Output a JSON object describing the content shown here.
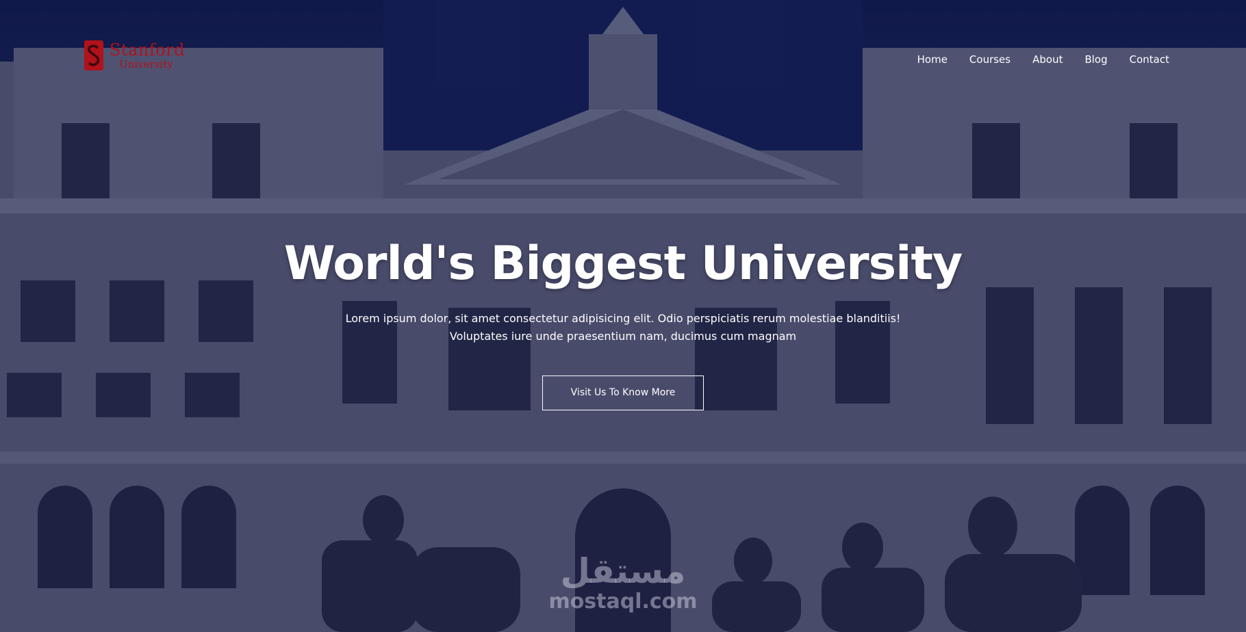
{
  "brand": {
    "name": "Stanford",
    "sub": "University",
    "color": "#b1121b"
  },
  "nav": {
    "items": [
      {
        "label": "Home"
      },
      {
        "label": "Courses"
      },
      {
        "label": "About"
      },
      {
        "label": "Blog"
      },
      {
        "label": "Contact"
      }
    ]
  },
  "hero": {
    "title": "World's Biggest University",
    "subtitle": "Lorem ipsum dolor, sit amet consectetur adipisicing elit. Odio perspiciatis rerum molestiae blanditiis! Voluptates iure unde praesentium nam, ducimus cum magnam",
    "cta_label": "Visit Us To Know More",
    "background": "university-building-photo"
  },
  "watermark": {
    "arabic": "مستقل",
    "latin": "mostaql.com"
  },
  "colors": {
    "overlay": "#141846",
    "text": "#ffffff"
  }
}
